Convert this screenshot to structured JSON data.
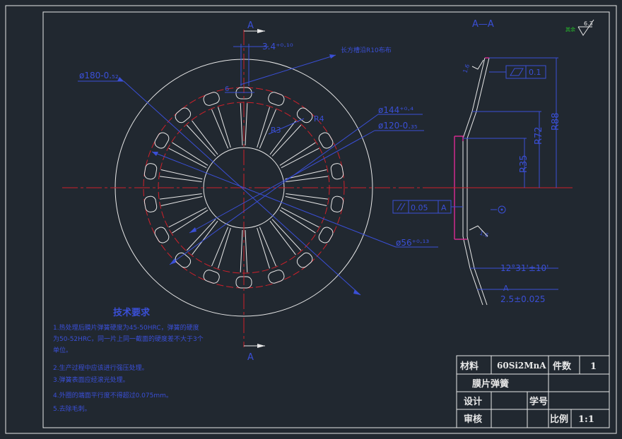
{
  "section_label": "A—A",
  "section_marks": [
    "A",
    "A"
  ],
  "roughness": {
    "symbol_label": "其余",
    "value": "6.3"
  },
  "dims": {
    "slot_width": "3.4⁺⁰·¹⁰",
    "slot_note": "长方槽沿R10布布",
    "d_outer": "ø180-0.₅₂",
    "d_mid": "ø144⁺⁰·⁴",
    "d_inner": "ø120-0.₃₅",
    "d_bore": "ø56⁺⁰·¹³",
    "r3": "R3",
    "r4": "R4",
    "r_small": "R3",
    "w6": "6",
    "r88": "R88",
    "r72": "R72",
    "r35": "R35",
    "angle": "12°31'±10'",
    "thickness": "2.5±0.025",
    "flat_tol": "0.1",
    "para_tol": "0.05",
    "datum": "A",
    "tilt_a": "1.6",
    "tilt_b": "1.6"
  },
  "tech": {
    "title": "技术要求",
    "lines": [
      "1.热处理后膜片弹簧硬度为45-50HRC，弹簧的硬度",
      "为50-52HRC，同一片上同一截面的硬度差不大于3个",
      "单位。",
      "2.生产过程中应该进行强压处理。",
      "3.弹簧表面应经滚光处理。",
      "4.外圈的端面平行度不得超过0.075mm。",
      "5.去除毛刺。"
    ]
  },
  "title_block": {
    "material_label": "材料",
    "material_value": "60Si2MnA",
    "count_label": "件数",
    "count_value": "1",
    "part_name": "膜片弹簧",
    "design_label": "设计",
    "student_id_label": "学号",
    "review_label": "审核",
    "scale_label": "比例",
    "scale_value": "1:1"
  },
  "colors": {
    "background": "#212830",
    "line_white": "#e8e8e8",
    "centerline_red": "#d0202a",
    "dimension_blue": "#3a4fd6",
    "symbol_magenta": "#d02a8e",
    "marker_green": "#26c02a"
  }
}
